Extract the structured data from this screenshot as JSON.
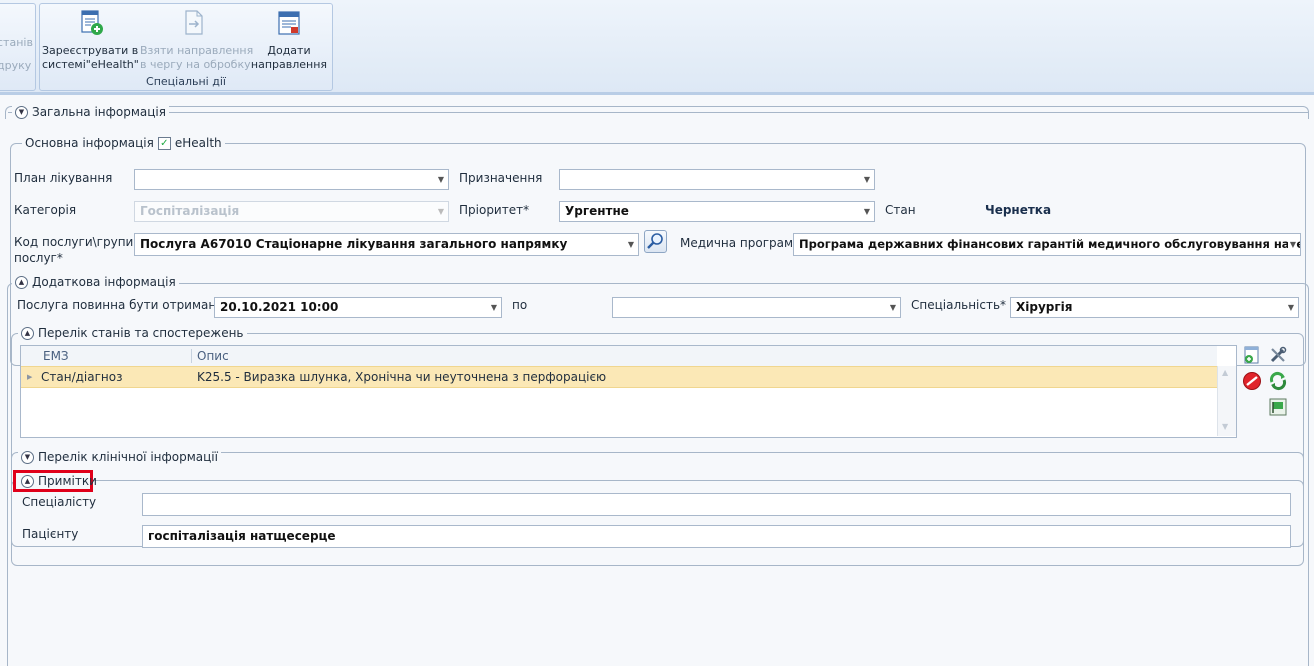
{
  "ribbon": {
    "left_cut_top": "станів",
    "left_cut_bottom": "друку",
    "buttons": [
      {
        "label": "Зареєструвати в\nсистемі\"eHealth\"",
        "icon": "register-ehealth-icon",
        "enabled": true
      },
      {
        "label": "Взяти направлення\nв чергу на обробку",
        "icon": "take-referral-icon",
        "enabled": false
      },
      {
        "label": "Додати\nнаправлення",
        "icon": "add-referral-icon",
        "enabled": true
      }
    ],
    "group_caption": "Спеціальні дії"
  },
  "general": {
    "title": "Загальна інформація",
    "basic": {
      "title": "Основна інформація",
      "ehealth_checked": true,
      "ehealth_label": "eHealth",
      "plan_label": "План лікування",
      "plan_value": "",
      "assignment_label": "Призначення",
      "assignment_value": "",
      "category_label": "Категорія",
      "category_value": "Госпіталізація",
      "priority_label": "Пріоритет*",
      "priority_value": "Ургентне",
      "state_label": "Стан",
      "state_value": "Чернетка",
      "service_code_label": "Код послуги\\групи\nпослуг*",
      "service_code_value": "Послуга А67010 Стаціонарне лікування загального напрямку",
      "medical_program_label": "Медична програма",
      "medical_program_value": "Програма державних фінансових гарантій медичного обслуговування населення"
    }
  },
  "additional": {
    "title": "Додаткова інформація",
    "service_from_label": "Послуга повинна бути отримана з",
    "service_from_value": "20.10.2021 10:00",
    "to_label": "по",
    "to_value": "",
    "specialty_label": "Спеціальність*",
    "specialty_value": "Хірургія",
    "states": {
      "title": "Перелік станів та спостережень",
      "columns": [
        "ЕМЗ",
        "Опис"
      ],
      "rows": [
        {
          "emz": "Стан/діагноз",
          "description": "K25.5 - Виразка шлунка, Хронічна чи неуточнена з перфорацією"
        }
      ]
    }
  },
  "clinical": {
    "title": "Перелік клінічної інформації"
  },
  "notes": {
    "title": "Примітки",
    "specialist_label": "Спеціалісту",
    "specialist_value": "",
    "patient_label": "Пацієнту",
    "patient_value": "госпіталізація натщесерце",
    "highlight_color": "#e0001a"
  }
}
